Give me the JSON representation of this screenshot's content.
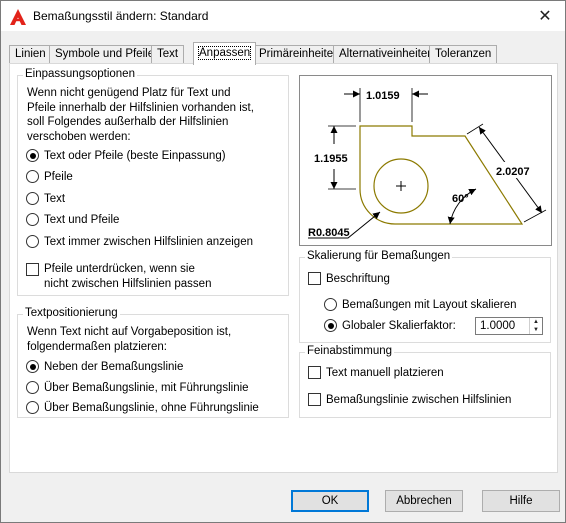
{
  "window": {
    "title": "Bemaßungsstil ändern: Standard",
    "close_symbol": "✕"
  },
  "tabs": [
    {
      "label": "Linien"
    },
    {
      "label": "Symbole und Pfeile"
    },
    {
      "label": "Text"
    },
    {
      "label": "Anpassen"
    },
    {
      "label": "Primäreinheiten"
    },
    {
      "label": "Alternativeinheiten"
    },
    {
      "label": "Toleranzen"
    }
  ],
  "active_tab": "Anpassen",
  "fit_options": {
    "legend": "Einpassungsoptionen",
    "description_lines": [
      "Wenn nicht genügend Platz für Text und",
      "Pfeile innerhalb der Hilfslinien vorhanden ist,",
      "soll Folgendes außerhalb der Hilfslinien",
      "verschoben werden:"
    ],
    "radios": [
      {
        "label": "Text oder Pfeile (beste Einpassung)",
        "selected": true
      },
      {
        "label": "Pfeile",
        "selected": false
      },
      {
        "label": "Text",
        "selected": false
      },
      {
        "label": "Text und Pfeile",
        "selected": false
      },
      {
        "label": "Text immer zwischen Hilfslinien anzeigen",
        "selected": false
      }
    ],
    "suppress_arrows": {
      "line1": "Pfeile unterdrücken, wenn sie",
      "line2": "nicht zwischen Hilfslinien passen",
      "checked": false
    }
  },
  "text_placement": {
    "legend": "Textpositionierung",
    "description_lines": [
      "Wenn Text nicht auf Vorgabeposition ist,",
      "folgendermaßen platzieren:"
    ],
    "radios": [
      {
        "label": "Neben der Bemaßungslinie",
        "selected": true
      },
      {
        "label": "Über Bemaßungslinie, mit Führungslinie",
        "selected": false
      },
      {
        "label": "Über Bemaßungslinie, ohne Führungslinie",
        "selected": false
      }
    ]
  },
  "preview": {
    "dim_top": "1.0159",
    "dim_left": "1.1955",
    "dim_right": "2.0207",
    "angle": "60°",
    "radius": "R0.8045",
    "outline_color": "#8c7a00"
  },
  "scale": {
    "legend": "Skalierung für Bemaßungen",
    "annotative": {
      "label": "Beschriftung",
      "checked": false
    },
    "radios": [
      {
        "label": "Bemaßungen mit Layout skalieren",
        "selected": false
      },
      {
        "label": "Globaler Skalierfaktor:",
        "selected": true
      }
    ],
    "scale_value": "1.0000"
  },
  "fine_tuning": {
    "legend": "Feinabstimmung",
    "checks": [
      {
        "label": "Text manuell platzieren",
        "checked": false
      },
      {
        "label": "Bemaßungslinie zwischen Hilfslinien",
        "checked": false
      }
    ]
  },
  "buttons": {
    "ok": "OK",
    "cancel": "Abbrechen",
    "help": "Hilfe"
  }
}
